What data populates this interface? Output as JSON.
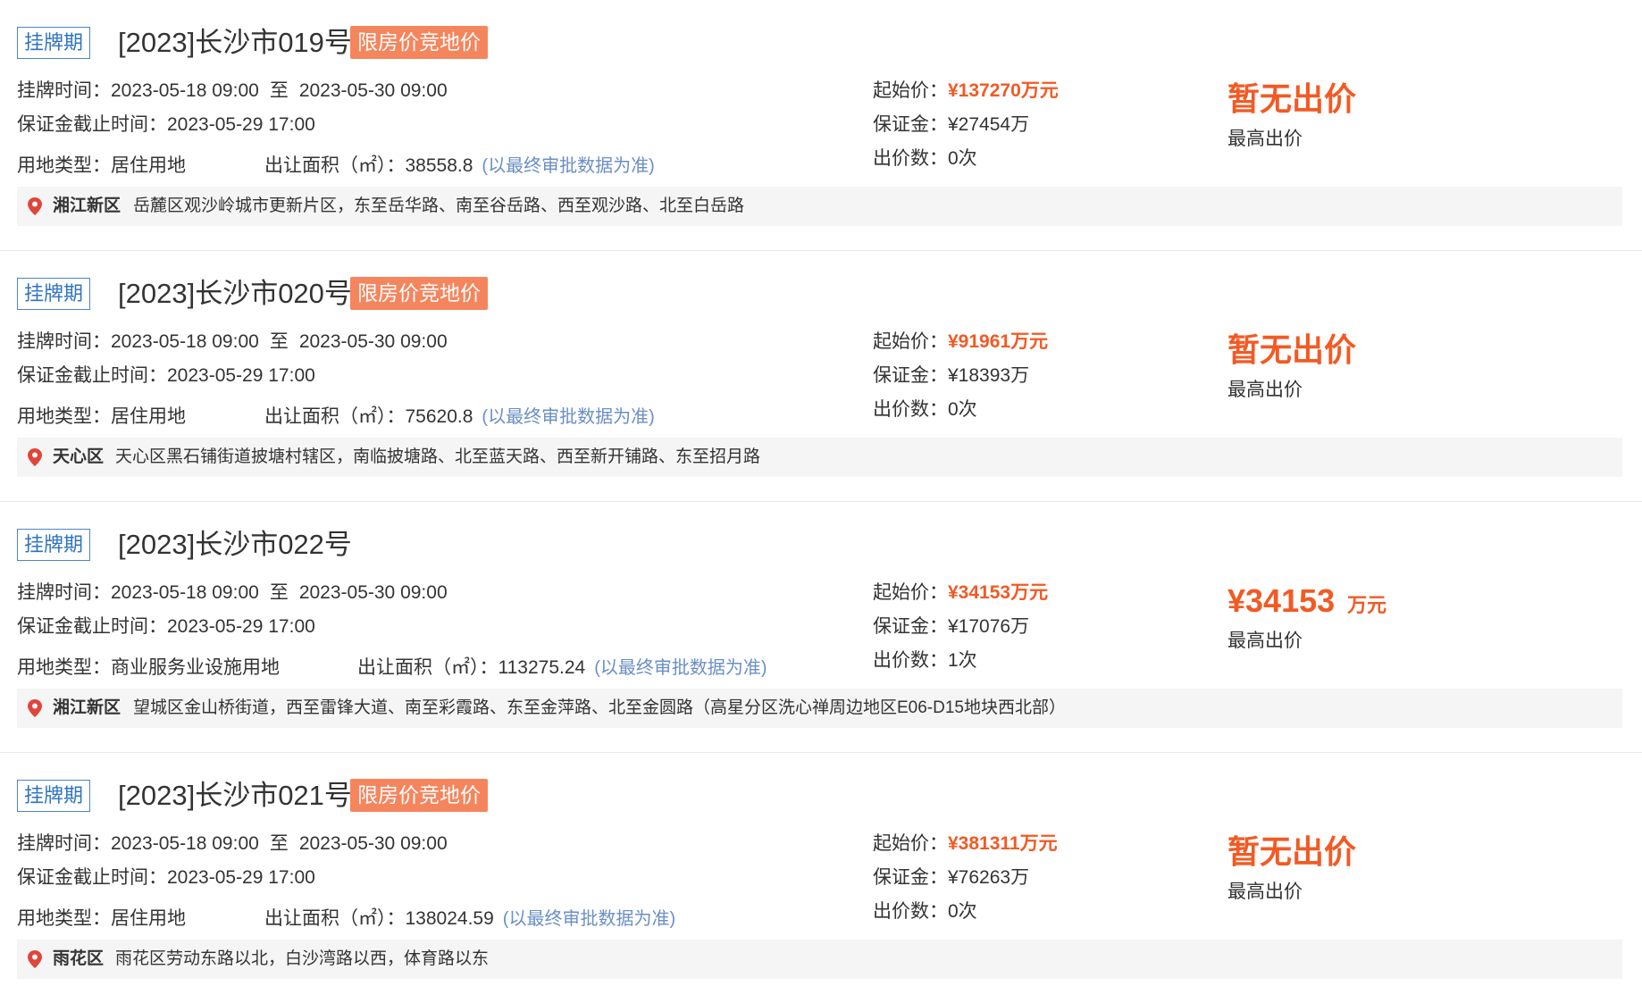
{
  "labels": {
    "listing_time": "挂牌时间：",
    "to": "至",
    "deposit_deadline": "保证金截止时间：",
    "land_type": "用地类型：",
    "area": "出让面积（㎡）：",
    "area_note": "(以最终审批数据为准)",
    "start_price": "起始价：",
    "deposit": "保证金：",
    "bid_count": "出价数：",
    "highest_bid": "最高出价"
  },
  "colors": {
    "accent": "#f25a24",
    "status_tag_border": "#4a86c8",
    "limit_tag_bg": "#f5855d",
    "note": "#6a8fc5",
    "location_bar_bg": "#f5f5f5"
  },
  "icons": {
    "location": "map-pin-icon"
  },
  "listings": [
    {
      "status": "挂牌期",
      "title": "[2023]长沙市019号",
      "tag": "限房价竞地价",
      "listing_start": "2023-05-18 09:00",
      "listing_end": "2023-05-30 09:00",
      "deposit_deadline": "2023-05-29 17:00",
      "land_type": "居住用地",
      "area": "38558.8",
      "start_price": "¥137270万元",
      "deposit": "¥27454万",
      "bid_count": "0次",
      "bid_status": "暂无出价",
      "bid_unit": "",
      "district": "湘江新区",
      "location": "岳麓区观沙岭城市更新片区，东至岳华路、南至谷岳路、西至观沙路、北至白岳路"
    },
    {
      "status": "挂牌期",
      "title": "[2023]长沙市020号",
      "tag": "限房价竞地价",
      "listing_start": "2023-05-18 09:00",
      "listing_end": "2023-05-30 09:00",
      "deposit_deadline": "2023-05-29 17:00",
      "land_type": "居住用地",
      "area": "75620.8",
      "start_price": "¥91961万元",
      "deposit": "¥18393万",
      "bid_count": "0次",
      "bid_status": "暂无出价",
      "bid_unit": "",
      "district": "天心区",
      "location": "天心区黑石铺街道披塘村辖区，南临披塘路、北至蓝天路、西至新开铺路、东至招月路"
    },
    {
      "status": "挂牌期",
      "title": "[2023]长沙市022号",
      "tag": "",
      "listing_start": "2023-05-18 09:00",
      "listing_end": "2023-05-30 09:00",
      "deposit_deadline": "2023-05-29 17:00",
      "land_type": "商业服务业设施用地",
      "area": "113275.24",
      "start_price": "¥34153万元",
      "deposit": "¥17076万",
      "bid_count": "1次",
      "bid_status": "¥34153",
      "bid_unit": "万元",
      "district": "湘江新区",
      "location": "望城区金山桥街道，西至雷锋大道、南至彩霞路、东至金萍路、北至金圆路（高星分区洗心禅周边地区E06-D15地块西北部）"
    },
    {
      "status": "挂牌期",
      "title": "[2023]长沙市021号",
      "tag": "限房价竞地价",
      "listing_start": "2023-05-18 09:00",
      "listing_end": "2023-05-30 09:00",
      "deposit_deadline": "2023-05-29 17:00",
      "land_type": "居住用地",
      "area": "138024.59",
      "start_price": "¥381311万元",
      "deposit": "¥76263万",
      "bid_count": "0次",
      "bid_status": "暂无出价",
      "bid_unit": "",
      "district": "雨花区",
      "location": "雨花区劳动东路以北，白沙湾路以西，体育路以东"
    }
  ]
}
